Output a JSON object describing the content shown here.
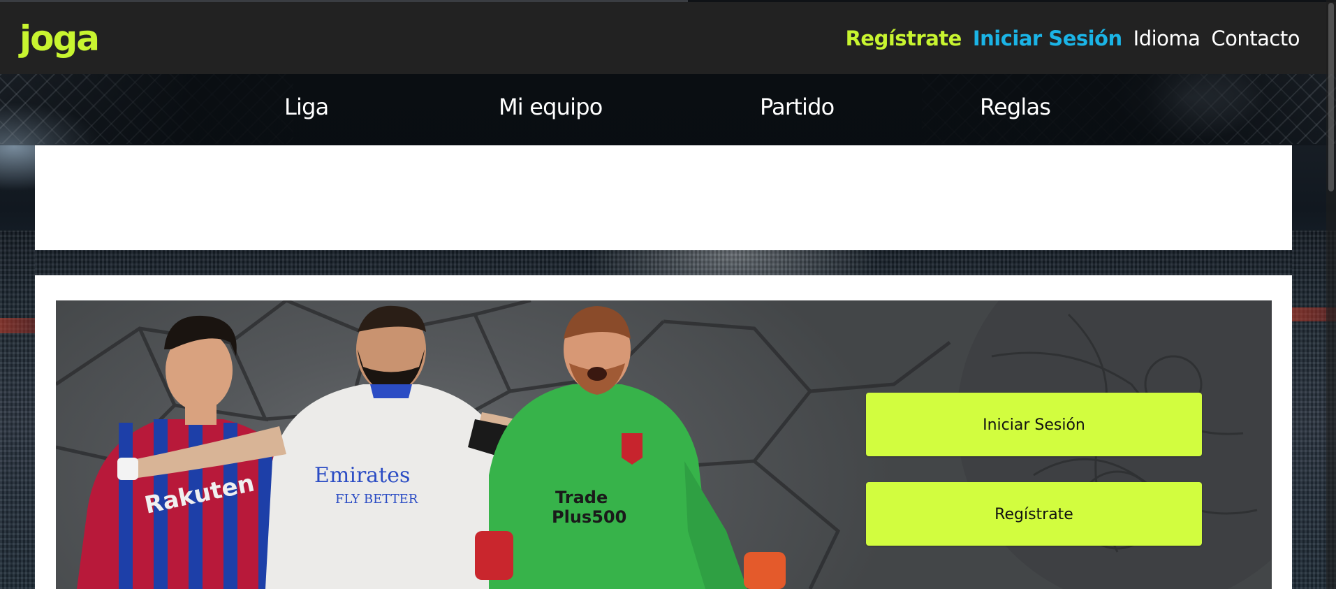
{
  "brand": {
    "logo_text": "joga",
    "accent_color": "#c8f530",
    "link_blue": "#1bb4e6",
    "button_color": "#d2fd3f"
  },
  "header": {
    "links": [
      {
        "label": "Regístrate"
      },
      {
        "label": "Iniciar Sesión"
      },
      {
        "label": "Idioma"
      },
      {
        "label": "Contacto"
      }
    ]
  },
  "nav": {
    "items": [
      {
        "label": "Liga"
      },
      {
        "label": "Mi equipo"
      },
      {
        "label": "Partido"
      },
      {
        "label": "Reglas"
      }
    ]
  },
  "hero": {
    "image": "hero-players-image",
    "login_button": "Iniciar Sesión",
    "register_button": "Regístrate"
  }
}
